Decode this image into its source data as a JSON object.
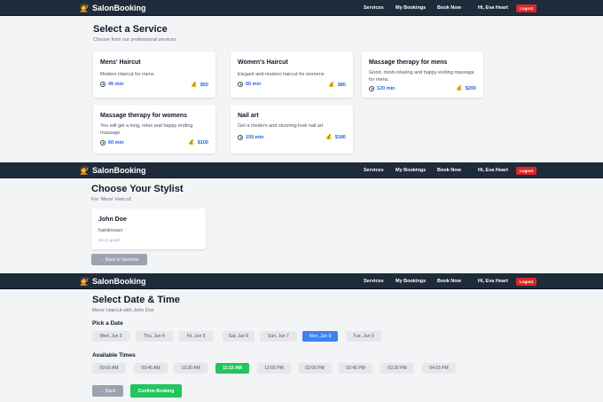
{
  "app": {
    "brand": "SalonBooking",
    "logo_icon": "salon-person-icon"
  },
  "nav": {
    "services": "Services",
    "my_bookings": "My Bookings",
    "book_now": "Book Now",
    "greeting": "Hi, Eva Heart",
    "logout": "Logout"
  },
  "services": {
    "title": "Select a Service",
    "subtitle": "Choose from our professional services",
    "items": [
      {
        "name": "Mens' Haircut",
        "desc": "Modern Haircut for mens",
        "duration": "45 min",
        "price": "$50"
      },
      {
        "name": "Women's Haircut",
        "desc": "Elegant and modern haircut for womens",
        "duration": "60 min",
        "price": "$80"
      },
      {
        "name": "Massage therapy for mens",
        "desc": "Good, mind-relaxing and happy ending massage for mens.",
        "duration": "120 min",
        "price": "$200"
      },
      {
        "name": "Massage therapy for womens",
        "desc": "You will get a long, relax and happy ending massage",
        "duration": "60 min",
        "price": "$100"
      },
      {
        "name": "Nail art",
        "desc": "Get a modern and stunning look nail art",
        "duration": "150 min",
        "price": "$180"
      }
    ]
  },
  "stylist": {
    "title": "Choose Your Stylist",
    "subtitle": "For 'Mens' Haircut'",
    "card": {
      "name": "John Doe",
      "role": "hairdresser",
      "note": "Ero is good!"
    },
    "back": "← Back to Services"
  },
  "datetime": {
    "title": "Select Date & Time",
    "subtitle": "Mens' Haircut with John Doe",
    "pick_date": "Pick a Date",
    "dates": [
      "Wed, Jun 3",
      "Thu, Jun 4",
      "Fri, Jun 5",
      "Sat, Jun 6",
      "Sun, Jun 7",
      "Mon, Jun 8",
      "Tue, Jun 9"
    ],
    "selected_date": "Mon, Jun 8",
    "available_times": "Available Times",
    "times": [
      "09:00 AM",
      "09:45 AM",
      "10:30 AM",
      "11:15 AM",
      "12:00 PM",
      "02:00 PM",
      "02:45 PM",
      "03:30 PM",
      "04:15 PM"
    ],
    "selected_time": "11:15 AM",
    "back": "← Back",
    "confirm": "Confirm Booking"
  },
  "colors": {
    "navbar": "#1e2b3a",
    "accent_blue": "#3b82f6",
    "accent_green": "#22c55e",
    "logout_red": "#dc2626"
  }
}
